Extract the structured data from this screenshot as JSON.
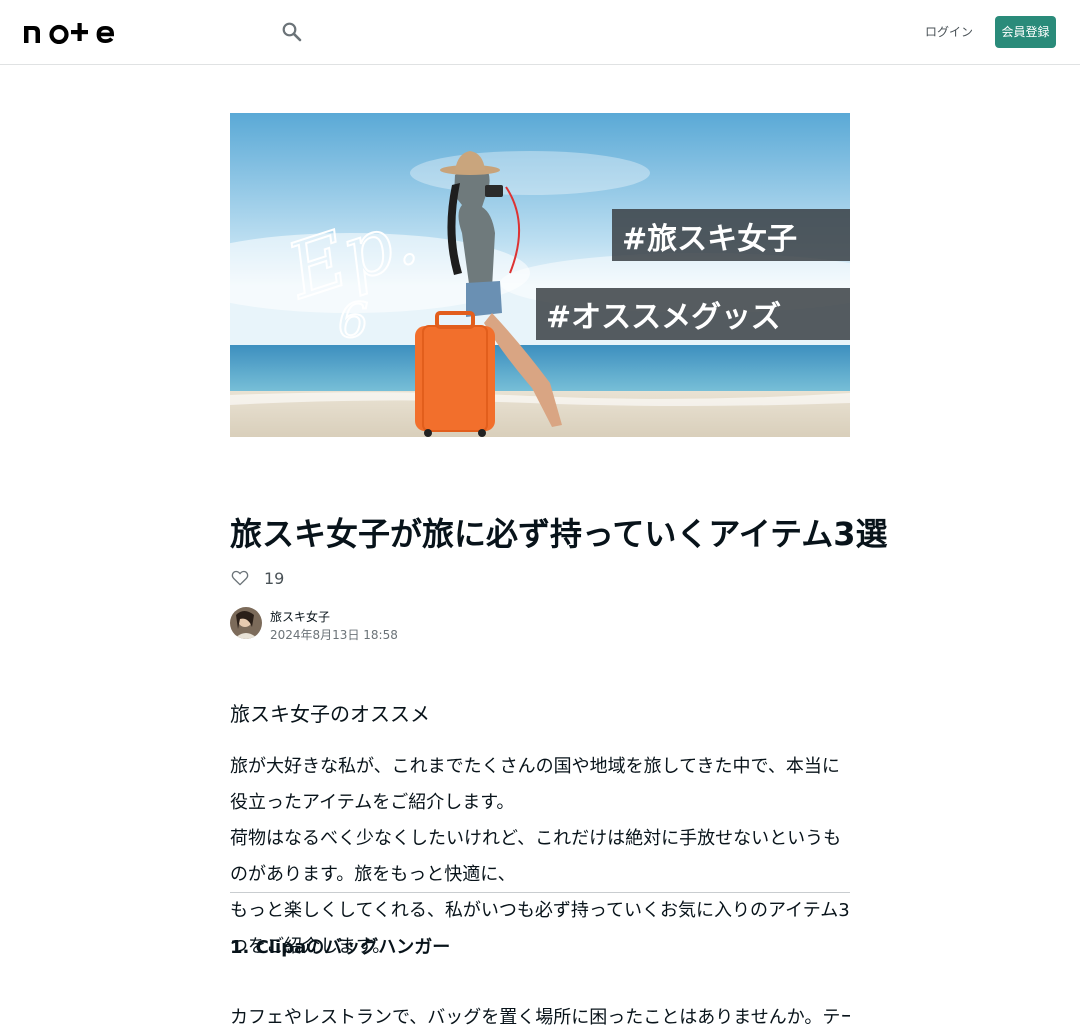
{
  "header": {
    "logo_text": "note",
    "login_label": "ログイン",
    "signup_label": "会員登録"
  },
  "hero": {
    "script_text": "Ep.",
    "episode_number": "6",
    "tag_1": "#旅スキ女子",
    "tag_2": "#オススメグッズ"
  },
  "article": {
    "title": "旅スキ女子が旅に必ず持っていくアイテム3選",
    "like_count": "19",
    "author_name": "旅スキ女子",
    "published": "2024年8月13日 18:58",
    "intro_heading": "旅スキ女子のオススメ",
    "intro_body": "旅が大好きな私が、これまでたくさんの国や地域を旅してきた中で、本当に役立ったアイテムをご紹介します。\n荷物はなるべく少なくしたいけれど、これだけは絶対に手放せないというものがあります。旅をもっと快適に、\nもっと楽しくしてくれる、私がいつも必ず持っていくお気に入りのアイテム3つをご紹介します。",
    "item1_heading": "1. Clipaのバッグハンガー",
    "item1_body": "カフェやレストランで、バッグを置く場所に困ったことはありませんか。テーブルに引っかけるだけでバッグを床に置かずに済むバッグハンガーです。"
  },
  "colors": {
    "accent": "#2a8b7a",
    "text": "#08131a",
    "muted": "#6b7378"
  },
  "icons": {
    "search": "search-icon",
    "like": "heart-icon"
  }
}
